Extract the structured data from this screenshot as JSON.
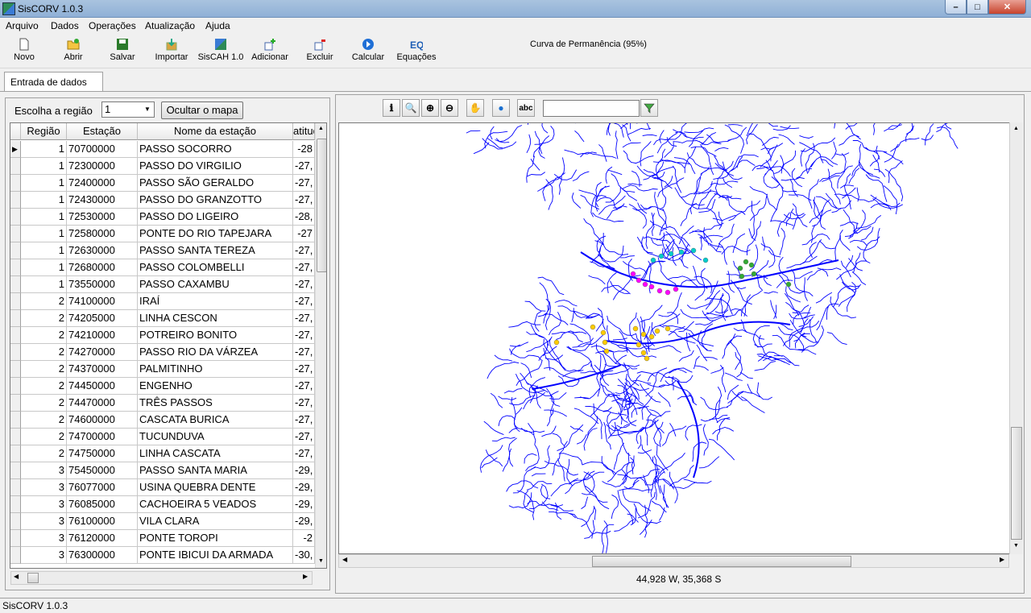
{
  "window": {
    "title": "SisCORV 1.0.3",
    "min": "–",
    "max": "□",
    "close": "✕"
  },
  "menu": [
    "Arquivo",
    "Dados",
    "Operações",
    "Atualização",
    "Ajuda"
  ],
  "toolbar": {
    "items": [
      {
        "label": "Novo",
        "icon": "new-file-icon"
      },
      {
        "label": "Abrir",
        "icon": "open-folder-icon"
      },
      {
        "label": "Salvar",
        "icon": "save-disk-icon"
      },
      {
        "label": "Importar",
        "icon": "import-icon"
      },
      {
        "label": "SisCAH 1.0",
        "icon": "siscah-icon"
      },
      {
        "label": "Adicionar",
        "icon": "add-icon"
      },
      {
        "label": "Excluir",
        "icon": "delete-icon"
      },
      {
        "label": "Calcular",
        "icon": "calculate-icon"
      },
      {
        "label": "Equações",
        "icon": "equations-icon"
      }
    ],
    "curve_label": "Curva de Permanência (95%)"
  },
  "tabs": [
    "Entrada de dados"
  ],
  "left": {
    "region_label": "Escolha a região",
    "region_value": "1",
    "hide_map": "Ocultar o mapa",
    "columns": [
      "Região",
      "Estação",
      "Nome da estação",
      "atitud"
    ],
    "rows": [
      [
        "1",
        "70700000",
        "PASSO SOCORRO",
        "-28"
      ],
      [
        "1",
        "72300000",
        "PASSO DO VIRGILIO",
        "-27,"
      ],
      [
        "1",
        "72400000",
        "PASSO SÃO GERALDO",
        "-27,"
      ],
      [
        "1",
        "72430000",
        "PASSO DO GRANZOTTO",
        "-27,"
      ],
      [
        "1",
        "72530000",
        "PASSO DO LIGEIRO",
        "-28,"
      ],
      [
        "1",
        "72580000",
        "PONTE DO RIO TAPEJARA",
        "-27"
      ],
      [
        "1",
        "72630000",
        "PASSO SANTA TEREZA",
        "-27,"
      ],
      [
        "1",
        "72680000",
        "PASSO COLOMBELLI",
        "-27,"
      ],
      [
        "1",
        "73550000",
        "PASSO CAXAMBU",
        "-27,"
      ],
      [
        "2",
        "74100000",
        "IRAÍ",
        "-27,"
      ],
      [
        "2",
        "74205000",
        "LINHA CESCON",
        "-27,"
      ],
      [
        "2",
        "74210000",
        "POTREIRO BONITO",
        "-27,"
      ],
      [
        "2",
        "74270000",
        "PASSO RIO DA VÁRZEA",
        "-27,"
      ],
      [
        "2",
        "74370000",
        "PALMITINHO",
        "-27,"
      ],
      [
        "2",
        "74450000",
        "ENGENHO",
        "-27,"
      ],
      [
        "2",
        "74470000",
        "TRÊS PASSOS",
        "-27,"
      ],
      [
        "2",
        "74600000",
        "CASCATA BURICA",
        "-27,"
      ],
      [
        "2",
        "74700000",
        "TUCUNDUVA",
        "-27,"
      ],
      [
        "2",
        "74750000",
        "LINHA CASCATA",
        "-27,"
      ],
      [
        "3",
        "75450000",
        "PASSO SANTA MARIA",
        "-29,"
      ],
      [
        "3",
        "76077000",
        "USINA QUEBRA DENTE",
        "-29,"
      ],
      [
        "3",
        "76085000",
        "CACHOEIRA 5 VEADOS",
        "-29,"
      ],
      [
        "3",
        "76100000",
        "VILA CLARA",
        "-29,"
      ],
      [
        "3",
        "76120000",
        "PONTE TOROPI",
        "-2"
      ],
      [
        "3",
        "76300000",
        "PONTE IBICUI DA ARMADA",
        "-30,"
      ]
    ]
  },
  "map": {
    "tools": [
      {
        "icon": "info-icon",
        "glyph": "ℹ"
      },
      {
        "icon": "search-zoom-icon",
        "glyph": "🔍"
      },
      {
        "icon": "zoom-in-icon",
        "glyph": "⊕"
      },
      {
        "icon": "zoom-out-icon",
        "glyph": "⊖"
      },
      {
        "icon": "pan-hand-icon",
        "glyph": "✋"
      },
      {
        "icon": "globe-icon",
        "glyph": "●"
      },
      {
        "icon": "label-abc-icon",
        "glyph": "abc"
      }
    ],
    "filter_icon": "filter-icon",
    "coords": "44,928 W, 35,368 S",
    "colors": {
      "rivers": "#0000ff",
      "region1": "#ff00ff",
      "region2": "#ffcc00",
      "cyan": "#00cccc",
      "green": "#33aa33"
    }
  },
  "status": "SisCORV 1.0.3"
}
